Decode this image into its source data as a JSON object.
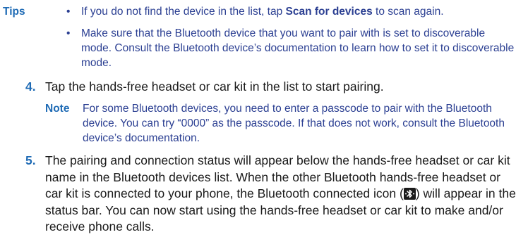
{
  "tips": {
    "label": "Tips",
    "bullet": "•",
    "items": [
      {
        "before": "If you do not find the device in the list, tap ",
        "bold": "Scan for devices",
        "after": " to scan again."
      },
      {
        "text": "Make sure that the Bluetooth device that you want to pair with is set to discoverable mode. Consult the Bluetooth device’s documentation to learn how to set it to discoverable mode."
      }
    ]
  },
  "steps": [
    {
      "number": "4.",
      "text": "Tap the hands-free headset or car kit in the list to start pairing."
    },
    {
      "number": "5.",
      "text_before_icon": "The pairing and connection status will appear below the hands-free headset or car kit name in the Bluetooth devices list. When the other Bluetooth hands-free headset or car kit is connected to your phone, the Bluetooth connected icon (",
      "text_after_icon": ") will appear in the status bar. You can now start using the hands-free headset or car kit to make and/or receive phone calls."
    }
  ],
  "note": {
    "label": "Note",
    "text": "For some Bluetooth devices, you need to enter a passcode to pair with the Bluetooth device. You can try “0000” as the passcode. If that does not work, consult the Bluetooth device’s documentation."
  },
  "icons": {
    "bluetooth_connected": "bluetooth-connected-icon"
  },
  "colors": {
    "accent": "#1f6bb5",
    "tip_text": "#2b3f92",
    "body_text": "#1a1a1a"
  }
}
